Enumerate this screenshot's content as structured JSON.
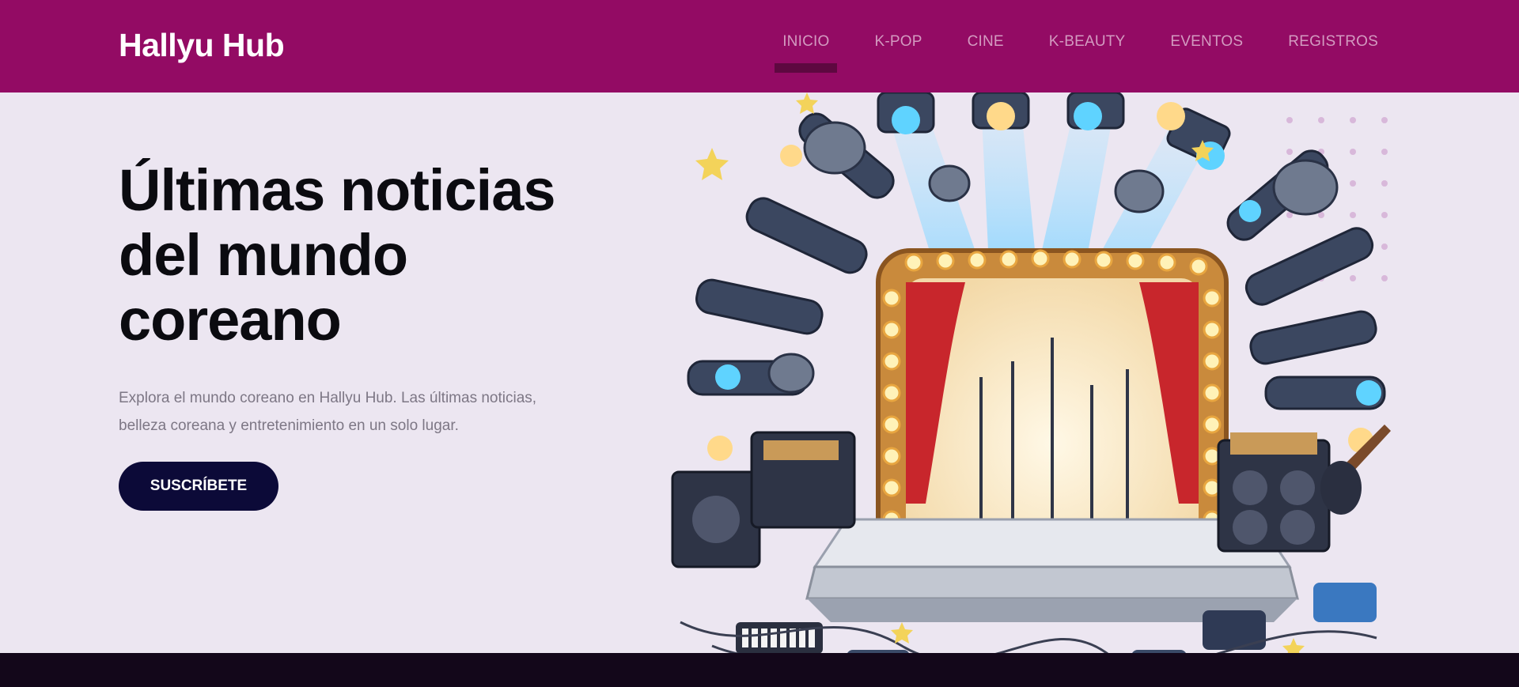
{
  "header": {
    "brand": "Hallyu Hub",
    "nav": [
      {
        "label": "INICIO",
        "active": true
      },
      {
        "label": "K-POP"
      },
      {
        "label": "CINE"
      },
      {
        "label": "K-BEAUTY"
      },
      {
        "label": "EVENTOS"
      },
      {
        "label": "REGISTROS"
      }
    ]
  },
  "hero": {
    "title_line1": "Últimas noticias",
    "title_line2": "del mundo",
    "title_line3": "coreano",
    "text_line1": "Explora el mundo coreano en Hallyu Hub. Las últimas noticias,",
    "text_line2": "belleza coreana y entretenimiento en un solo lugar.",
    "cta_label": "SUSCRÍBETE",
    "illustration": "concert-stage-illustration"
  },
  "colors": {
    "navbar": "#930b64",
    "page_background": "#ece6f1",
    "button": "#0c0a38",
    "footer": "#13071a"
  }
}
